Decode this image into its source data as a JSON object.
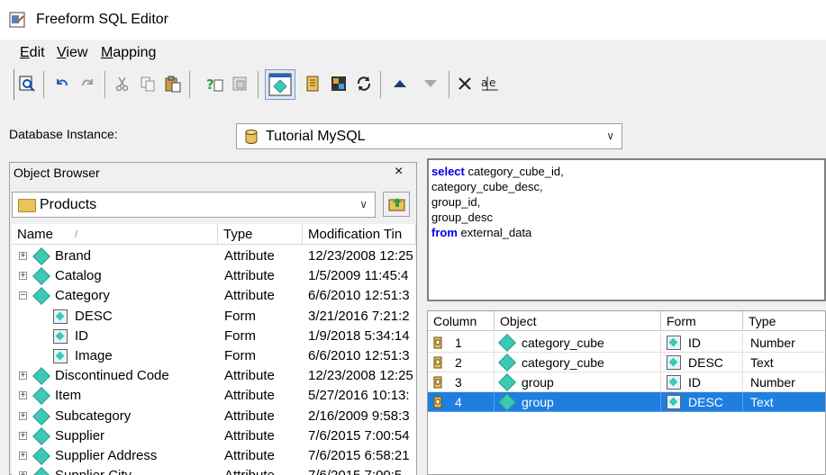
{
  "window": {
    "title": "Freeform SQL Editor"
  },
  "menu": [
    {
      "label": "Edit",
      "mnemonic": "E",
      "rest": "dit"
    },
    {
      "label": "View",
      "mnemonic": "V",
      "rest": "iew"
    },
    {
      "label": "Mapping",
      "mnemonic": "M",
      "rest": "apping"
    }
  ],
  "toolbar": {
    "icons": [
      "validate-icon",
      "undo-icon",
      "redo-icon",
      "cut-icon",
      "copy-icon",
      "paste-icon",
      "help-icon",
      "insert-prompt-icon",
      "object-browser-toggle-icon",
      "report-icon",
      "map-icon",
      "refresh-icon",
      "move-up-icon",
      "move-down-icon",
      "delete-icon",
      "rename-icon"
    ]
  },
  "database": {
    "label": "Database Instance:",
    "value": "Tutorial MySQL"
  },
  "object_browser": {
    "title": "Object Browser",
    "close": "×",
    "folder": "Products",
    "columns": [
      "Name",
      "Type",
      "Modification Tin"
    ],
    "rows": [
      {
        "name": "Brand",
        "type": "Attribute",
        "modified": "12/23/2008 12:25",
        "kind": "attribute",
        "expander": "+"
      },
      {
        "name": "Catalog",
        "type": "Attribute",
        "modified": "1/5/2009 11:45:4",
        "kind": "attribute",
        "expander": "+"
      },
      {
        "name": "Category",
        "type": "Attribute",
        "modified": "6/6/2010 12:51:3",
        "kind": "attribute",
        "expander": "−"
      },
      {
        "name": "DESC",
        "type": "Form",
        "modified": "3/21/2016 7:21:2",
        "kind": "form",
        "expander": ""
      },
      {
        "name": "ID",
        "type": "Form",
        "modified": "1/9/2018 5:34:14",
        "kind": "form",
        "expander": ""
      },
      {
        "name": "Image",
        "type": "Form",
        "modified": "6/6/2010 12:51:3",
        "kind": "form",
        "expander": ""
      },
      {
        "name": "Discontinued Code",
        "type": "Attribute",
        "modified": "12/23/2008 12:25",
        "kind": "attribute",
        "expander": "+"
      },
      {
        "name": "Item",
        "type": "Attribute",
        "modified": "5/27/2016 10:13:",
        "kind": "attribute",
        "expander": "+"
      },
      {
        "name": "Subcategory",
        "type": "Attribute",
        "modified": "2/16/2009 9:58:3",
        "kind": "attribute",
        "expander": "+"
      },
      {
        "name": "Supplier",
        "type": "Attribute",
        "modified": "7/6/2015 7:00:54",
        "kind": "attribute",
        "expander": "+"
      },
      {
        "name": "Supplier Address",
        "type": "Attribute",
        "modified": "7/6/2015 6:58:21",
        "kind": "attribute",
        "expander": "+"
      },
      {
        "name": "Supplier City",
        "type": "Attribute",
        "modified": "7/6/2015 7:00:5",
        "kind": "attribute",
        "expander": "+"
      }
    ]
  },
  "sql": {
    "lines": [
      {
        "kw": "select",
        "text": " category_cube_id,"
      },
      {
        "kw": "",
        "text": "category_cube_desc,"
      },
      {
        "kw": "",
        "text": "group_id,"
      },
      {
        "kw": "",
        "text": "group_desc"
      },
      {
        "kw": "from",
        "text": " external_data"
      }
    ]
  },
  "mapping_grid": {
    "columns": [
      "Column",
      "Object",
      "Form",
      "Type"
    ],
    "rows": [
      {
        "column": "1",
        "object": "category_cube",
        "form": "ID",
        "type": "Number",
        "selected": false
      },
      {
        "column": "2",
        "object": "category_cube",
        "form": "DESC",
        "type": "Text",
        "selected": false
      },
      {
        "column": "3",
        "object": "group",
        "form": "ID",
        "type": "Number",
        "selected": false
      },
      {
        "column": "4",
        "object": "group",
        "form": "DESC",
        "type": "Text",
        "selected": true
      }
    ]
  },
  "colors": {
    "selection": "#1e7fe0",
    "attribute_icon": "#3fc8b4",
    "keyword": "#0000e0"
  }
}
